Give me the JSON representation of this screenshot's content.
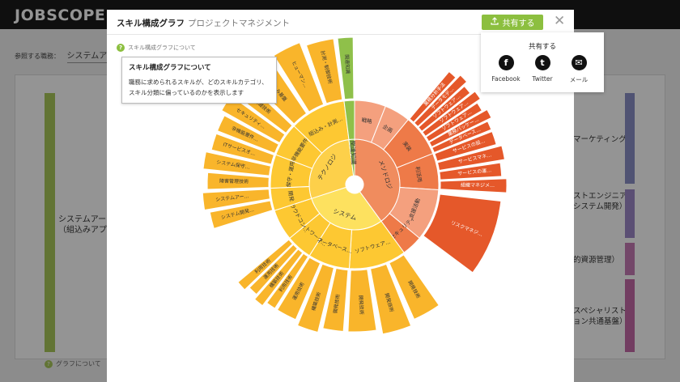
{
  "app": {
    "logo": "JOBSCOPE.",
    "breadcrumb_label": "参照する職務：",
    "breadcrumb_value": "システムアー",
    "left_block_label": "システムアー\n（組込みアプリ",
    "help_text": "グラフについて",
    "right_items": [
      {
        "label": "マーケティング",
        "color": "#8b8fc6"
      },
      {
        "label": "ストエンジニア\nシステム開発）",
        "color": "#9d88c8"
      },
      {
        "label": "的資源管理）",
        "color": "#c77bb5"
      },
      {
        "label": "スペシャリスト\nョン共通基盤）",
        "color": "#c46aa8"
      }
    ]
  },
  "modal": {
    "tabs": [
      "スキル構成グラフ",
      "プロジェクトマネジメント"
    ],
    "share_label": "共有する",
    "close_symbol": "✕",
    "help_link": "スキル構成グラフについて",
    "tooltip": {
      "title": "スキル構成グラフについて",
      "body": "職務に求められるスキルが、どのスキルカテゴリ、\nスキル分類に偏っているのかを表示します"
    },
    "share_popup": {
      "title": "共有する",
      "items": [
        {
          "label": "Facebook",
          "icon": "facebook-icon",
          "glyph": "f"
        },
        {
          "label": "Twitter",
          "icon": "twitter-icon",
          "glyph": "t"
        },
        {
          "label": "メール",
          "icon": "mail-icon",
          "glyph": "✉"
        }
      ]
    }
  },
  "colors": {
    "green": "#8cbf3f",
    "method_inner": "#f08c5e",
    "method_mid": "#ee7a48",
    "method_outer": "#e5582a",
    "method_light": "#f4a07e",
    "tech_inner": "#fdd04a",
    "tech_mid": "#fdc832",
    "tech_outer": "#f9b52b",
    "system_inner": "#fde15f",
    "green_small": "#8fc04a"
  },
  "chart_data": {
    "type": "sunburst",
    "rings": [
      {
        "name": "メソドロジ",
        "value": 40,
        "color": "#f08c5e",
        "children": [
          {
            "name": "戦略",
            "value": 6,
            "color": "#f4a07e",
            "children": []
          },
          {
            "name": "企画",
            "value": 5,
            "color": "#f4a07e",
            "children": []
          },
          {
            "name": "実装",
            "value": 8,
            "color": "#ee7a48",
            "children": [
              {
                "name": "業務分析手法",
                "value": 1.3
              },
              {
                "name": "データモデ…",
                "value": 1.3
              },
              {
                "name": "ソフトウェア…",
                "value": 1.3
              },
              {
                "name": "ソフトウェア…",
                "value": 1.3
              },
              {
                "name": "ソフトウェア…",
                "value": 1.3
              },
              {
                "name": "業務パッケー…",
                "value": 1.3
              },
              {
                "name": "データベース…",
                "value": 0.2
              }
            ]
          },
          {
            "name": "利活用",
            "value": 7,
            "color": "#ee7a48",
            "children": [
              {
                "name": "サービスの設…",
                "value": 1.75
              },
              {
                "name": "サービスマネ…",
                "value": 1.75
              },
              {
                "name": "サービスの運…",
                "value": 1.75
              },
              {
                "name": "組織マネジメ…",
                "value": 1.75
              }
            ]
          },
          {
            "name": "支援活動",
            "value": 10,
            "color": "#f4a07e",
            "children": [
              {
                "name": "リスクマネジ…",
                "value": 2.5
              }
            ]
          },
          {
            "name": "情報セキュリティ",
            "value": 4,
            "color": "#ee7a48",
            "children": []
          }
        ]
      },
      {
        "name": "システム",
        "value": 30,
        "color": "#fde15f",
        "children": [
          {
            "name": "ソフトウェア…",
            "value": 11,
            "color": "#fdc832",
            "children": [
              {
                "name": "開発技術",
                "value": 2
              },
              {
                "name": "開発技術",
                "value": 2
              },
              {
                "name": "開発技術",
                "value": 2
              }
            ]
          },
          {
            "name": "データベース…",
            "value": 8,
            "color": "#fdc832",
            "children": [
              {
                "name": "開発技術",
                "value": 2
              },
              {
                "name": "構築技術",
                "value": 2
              },
              {
                "name": "運用技術",
                "value": 2
              }
            ]
          },
          {
            "name": "ネットワーク…",
            "value": 5,
            "color": "#fdc832",
            "children": [
              {
                "name": "利用技術",
                "value": 1.5
              },
              {
                "name": "構築技術",
                "value": 1.5
              },
              {
                "name": "運用技術",
                "value": 1.5
              },
              {
                "name": "利用技術",
                "value": 1.5
              }
            ]
          },
          {
            "name": "クラウドコン…",
            "value": 6,
            "color": "#fdc832",
            "children": []
          }
        ]
      },
      {
        "name": "テクノロジ",
        "value": 28,
        "color": "#fdd04a",
        "children": [
          {
            "name": "開発",
            "value": 4,
            "color": "#fdc832",
            "children": [
              {
                "name": "システム開発…",
                "value": 2
              },
              {
                "name": "システムアー…",
                "value": 2
              }
            ]
          },
          {
            "name": "保守・運用",
            "value": 6,
            "color": "#fdc832",
            "children": [
              {
                "name": "障害管理技術",
                "value": 1.5
              },
              {
                "name": "システム保守…",
                "value": 1.5
              },
              {
                "name": "ITサービスオ…",
                "value": 1.5
              }
            ]
          },
          {
            "name": "非機能要件",
            "value": 6,
            "color": "#fdc832",
            "children": [
              {
                "name": "非機能要件…",
                "value": 2
              },
              {
                "name": "セキュリティ…",
                "value": 2
              },
              {
                "name": "基礎技術",
                "value": 2
              }
            ]
          },
          {
            "name": "組込み・計測…",
            "value": 10,
            "color": "#fdc832",
            "children": [
              {
                "name": "組込み基盤",
                "value": 2
              },
              {
                "name": "ヒューマン…",
                "value": 2
              },
              {
                "name": "計測・制御技術",
                "value": 2
              }
            ]
          }
        ]
      },
      {
        "name": "関連知識",
        "value": 2,
        "color": "#8fc04a",
        "children": [
          {
            "name": "",
            "value": 2,
            "color": "#8fc04a",
            "children": [
              {
                "name": "関連知識",
                "value": 1
              }
            ]
          }
        ]
      }
    ]
  }
}
